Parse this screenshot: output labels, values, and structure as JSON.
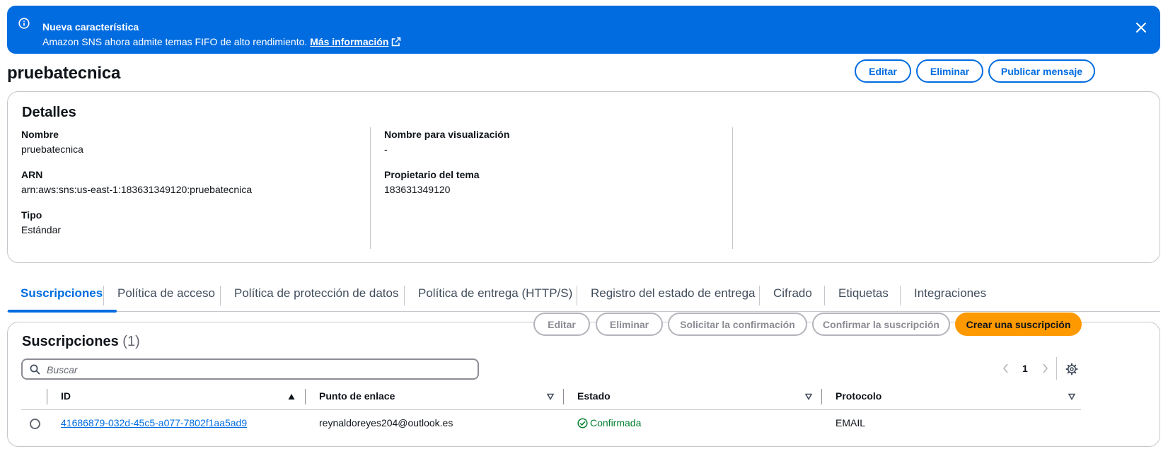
{
  "flash": {
    "title": "Nueva característica",
    "message": "Amazon SNS ahora admite temas FIFO de alto rendimiento.",
    "link": "Más información"
  },
  "header": {
    "title": "pruebatecnica",
    "buttons": {
      "edit": "Editar",
      "delete": "Eliminar",
      "publish": "Publicar mensaje"
    }
  },
  "details": {
    "title": "Detalles",
    "name_label": "Nombre",
    "name_value": "pruebatecnica",
    "arn_label": "ARN",
    "arn_value": "arn:aws:sns:us-east-1:183631349120:pruebatecnica",
    "type_label": "Tipo",
    "type_value": "Estándar",
    "display_name_label": "Nombre para visualización",
    "display_name_value": "-",
    "owner_label": "Propietario del tema",
    "owner_value": "183631349120"
  },
  "tabs": [
    "Suscripciones",
    "Política de acceso",
    "Política de protección de datos",
    "Política de entrega (HTTP/S)",
    "Registro del estado de entrega",
    "Cifrado",
    "Etiquetas",
    "Integraciones"
  ],
  "subscriptions": {
    "title": "Suscripciones",
    "count": "(1)",
    "buttons": {
      "edit": "Editar",
      "delete": "Eliminar",
      "request_confirm": "Solicitar la confirmación",
      "confirm": "Confirmar la suscripción",
      "create": "Crear una suscripción"
    },
    "search_placeholder": "Buscar",
    "page": "1",
    "columns": [
      "ID",
      "Punto de enlace",
      "Estado",
      "Protocolo"
    ],
    "rows": [
      {
        "id": "41686879-032d-45c5-a077-7802f1aa5ad9",
        "endpoint": "reynaldoreyes204@outlook.es",
        "status": "Confirmada",
        "protocol": "EMAIL"
      }
    ]
  }
}
